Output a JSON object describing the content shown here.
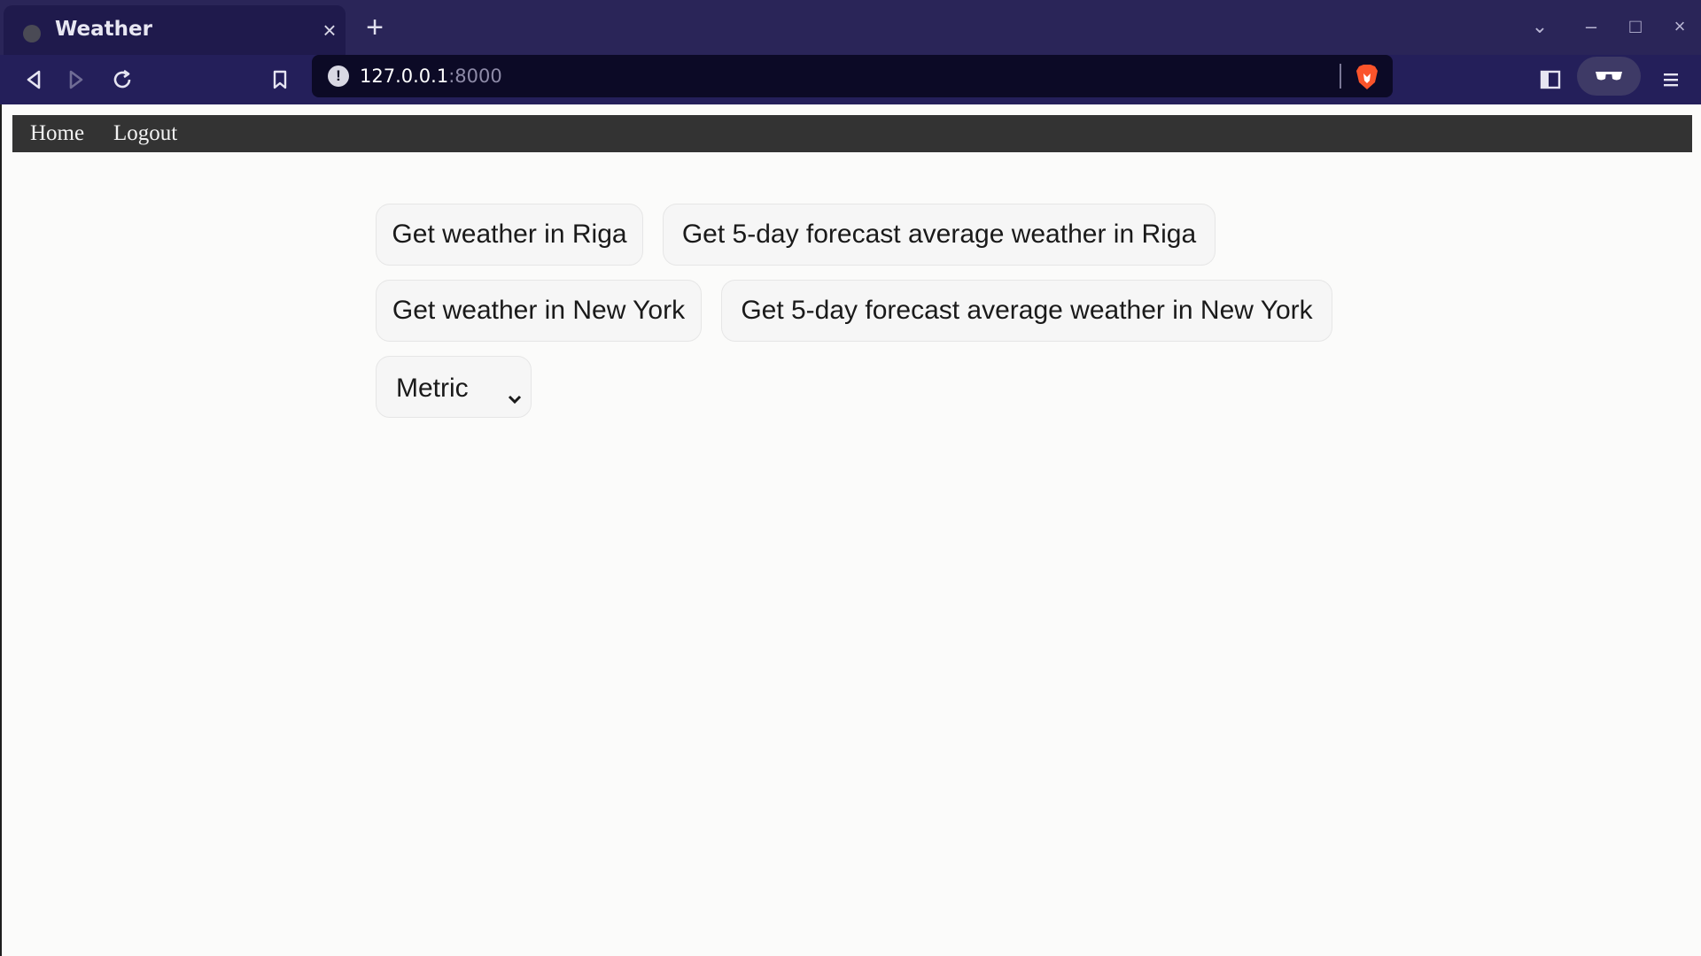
{
  "browser": {
    "tab_title": "Weather",
    "tab_close": "×",
    "new_tab": "+",
    "url_host": "127.0.0.1",
    "url_port": ":8000",
    "window_controls": {
      "dropdown": "⌄",
      "minimize": "–",
      "maximize": "□",
      "close": "×"
    }
  },
  "navbar": {
    "links": [
      {
        "label": "Home"
      },
      {
        "label": "Logout"
      }
    ]
  },
  "actions": {
    "riga_weather": "Get weather in Riga",
    "riga_forecast": "Get 5-day forecast average weather in Riga",
    "ny_weather": "Get weather in New York",
    "ny_forecast": "Get 5-day forecast average weather in New York"
  },
  "units_select": {
    "selected": "Metric"
  },
  "colors": {
    "chrome_bg": "#241f5a",
    "navbar_bg": "#333333",
    "page_bg": "#fbfbfa",
    "button_bg": "#f6f6f6"
  }
}
